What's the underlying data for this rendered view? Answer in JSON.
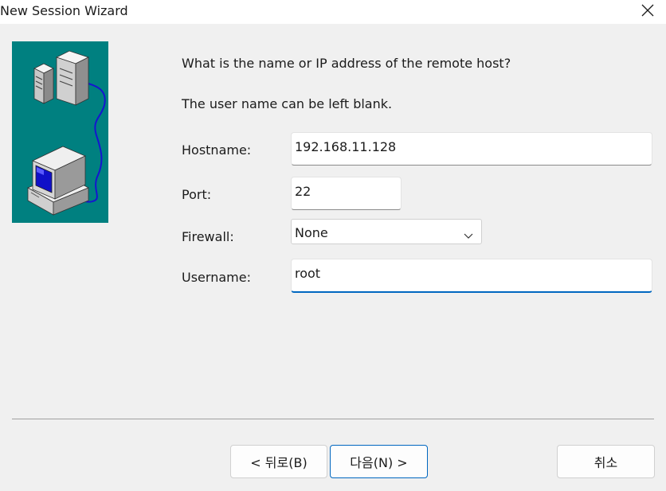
{
  "window": {
    "title": "New Session Wizard"
  },
  "prompt": {
    "question": "What is the name or IP address of the remote host?",
    "note": "The user name can be left blank."
  },
  "form": {
    "hostname": {
      "label": "Hostname:",
      "value": "192.168.11.128"
    },
    "port": {
      "label": "Port:",
      "value": "22"
    },
    "firewall": {
      "label": "Firewall:",
      "selected": "None"
    },
    "username": {
      "label": "Username:",
      "value": "root"
    }
  },
  "buttons": {
    "back": "< 뒤로(B)",
    "next": "다음(N) >",
    "cancel": "취소"
  },
  "icons": {
    "close": "close-icon",
    "dropdown": "chevron-down-icon",
    "illustration": "server-computer-network-illustration"
  },
  "colors": {
    "illustration_bg": "#008080",
    "focus_accent": "#0067c0",
    "window_bg": "#f0f0f0"
  }
}
